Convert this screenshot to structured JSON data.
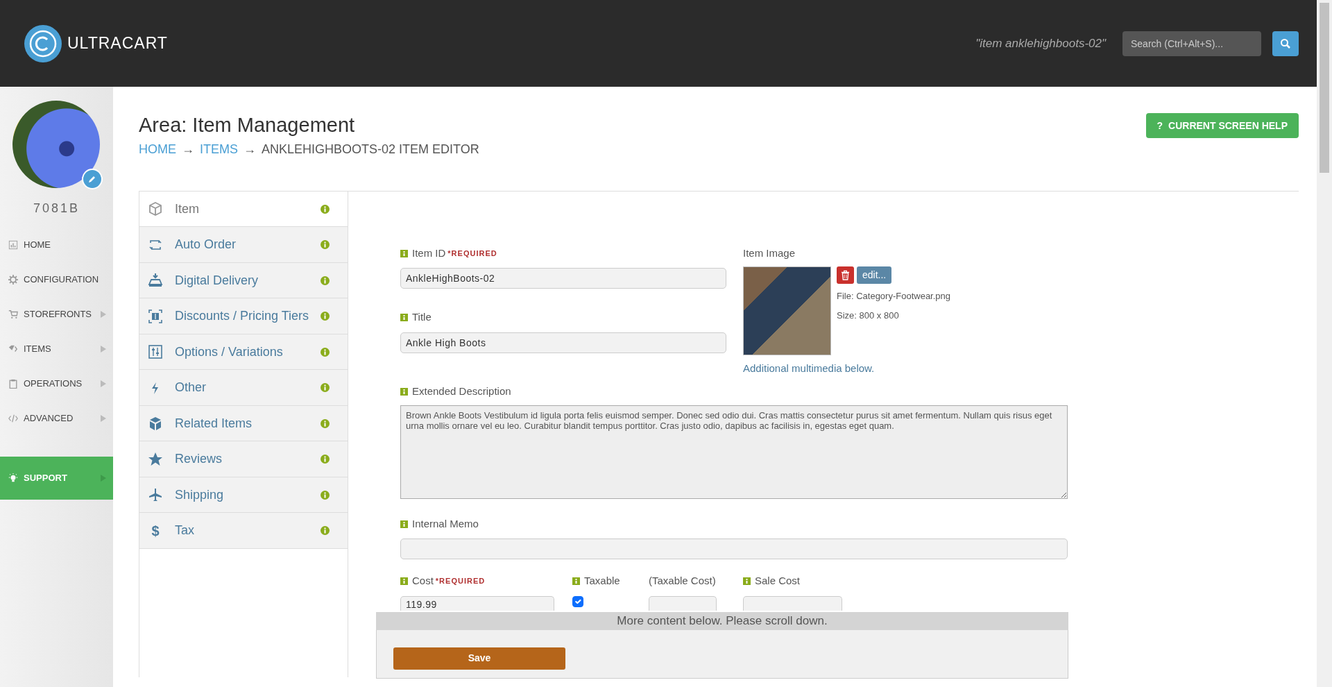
{
  "header": {
    "logo": "ULTRACART",
    "search_context": "\"item anklehighboots-02\"",
    "search": {
      "placeholder": "Search (Ctrl+Alt+S)..."
    }
  },
  "sidebar": {
    "account": "7081B",
    "items": [
      {
        "label": "HOME",
        "selected": false,
        "submenu": false
      },
      {
        "label": "CONFIGURATION",
        "selected": false,
        "submenu": false
      },
      {
        "label": "STOREFRONTS",
        "selected": false,
        "submenu": true
      },
      {
        "label": "ITEMS",
        "selected": false,
        "submenu": true
      },
      {
        "label": "OPERATIONS",
        "selected": false,
        "submenu": true
      },
      {
        "label": "ADVANCED",
        "selected": false,
        "submenu": true
      },
      {
        "label": "SUPPORT",
        "selected": true,
        "submenu": true
      }
    ]
  },
  "page": {
    "area_title": "Area: Item Management",
    "breadcrumb": [
      {
        "label": "HOME",
        "link": true
      },
      {
        "label": "ITEMS",
        "link": true
      },
      {
        "label": "ANKLEHIGHBOOTS-02 ITEM EDITOR",
        "link": false
      }
    ],
    "separators": [
      "→",
      "→"
    ],
    "help_button": {
      "glyph": "?",
      "label": "CURRENT SCREEN HELP"
    }
  },
  "tabs": [
    {
      "label": "Item",
      "selected": true
    },
    {
      "label": "Auto Order",
      "selected": false
    },
    {
      "label": "Digital Delivery",
      "selected": false
    },
    {
      "label": "Discounts / Pricing Tiers",
      "selected": false
    },
    {
      "label": "Options / Variations",
      "selected": false
    },
    {
      "label": "Other",
      "selected": false
    },
    {
      "label": "Related Items",
      "selected": false
    },
    {
      "label": "Reviews",
      "selected": false
    },
    {
      "label": "Shipping",
      "selected": false
    },
    {
      "label": "Tax",
      "selected": false,
      "glyph": "$"
    }
  ],
  "form": {
    "item_id": {
      "label": "Item ID",
      "required_note": "*REQUIRED",
      "value": "AnkleHighBoots-02"
    },
    "title": {
      "label": "Title",
      "value": "Ankle High Boots"
    },
    "item_image": {
      "label": "Item Image",
      "edit_button": "edit...",
      "file": "File: Category-Footwear.png",
      "size": "Size: 800 x 800",
      "multimedia_link": "Additional multimedia below."
    },
    "extended_description": {
      "label": "Extended Description",
      "value": "Brown Ankle Boots Vestibulum id ligula porta felis euismod semper. Donec sed odio dui. Cras mattis consectetur purus sit amet fermentum. Nullam quis risus eget urna mollis ornare vel eu leo. Curabitur blandit tempus porttitor. Cras justo odio, dapibus ac facilisis in, egestas eget quam."
    },
    "internal_memo": {
      "label": "Internal Memo"
    },
    "cost": {
      "label": "Cost",
      "required_note": "*REQUIRED",
      "value": "119.99"
    },
    "taxable": {
      "label": "Taxable",
      "checked": true
    },
    "taxable_cost": {
      "label": "(Taxable Cost)"
    },
    "sale_cost": {
      "label": "Sale Cost"
    }
  },
  "scroll_notice": "More content below. Please scroll down.",
  "save_button": "Save"
}
